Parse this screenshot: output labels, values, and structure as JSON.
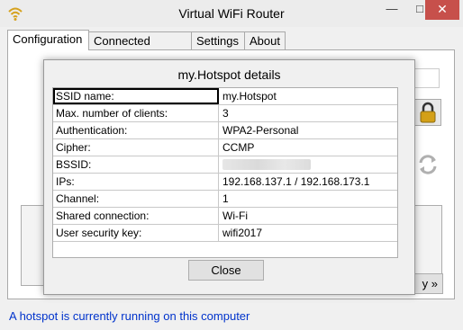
{
  "window": {
    "title": "Virtual WiFi Router",
    "minimize": "—",
    "maximize": "□",
    "close": "✕"
  },
  "tabs": [
    {
      "label": "Configuration",
      "active": true
    },
    {
      "label": "Connected clients",
      "active": false
    },
    {
      "label": "Settings",
      "active": false
    },
    {
      "label": "About",
      "active": false
    }
  ],
  "background": {
    "button_label": "y »"
  },
  "status": {
    "text": "A hotspot is currently running on this computer",
    "color": "#0033cc"
  },
  "dialog": {
    "title": "my.Hotspot details",
    "rows": [
      {
        "label": "SSID name:",
        "value": "my.Hotspot"
      },
      {
        "label": "Max. number of clients:",
        "value": "3"
      },
      {
        "label": "Authentication:",
        "value": "WPA2-Personal"
      },
      {
        "label": "Cipher:",
        "value": "CCMP"
      },
      {
        "label": "BSSID:",
        "value": ""
      },
      {
        "label": "IPs:",
        "value": "192.168.137.1 / 192.168.173.1"
      },
      {
        "label": "Channel:",
        "value": "1"
      },
      {
        "label": "Shared connection:",
        "value": "Wi-Fi"
      },
      {
        "label": "User security key:",
        "value": "wifi2017"
      }
    ],
    "close_label": "Close"
  },
  "icons": {
    "app": "wifi-icon",
    "lock": "lock-icon",
    "refresh": "refresh-icon"
  }
}
